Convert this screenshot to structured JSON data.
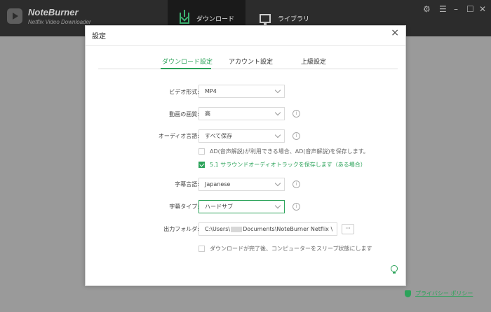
{
  "app": {
    "name": "NoteBurner",
    "subtitle": "Netflix Video Downloader",
    "nav": {
      "download": "ダウンロード",
      "library": "ライブラリ"
    }
  },
  "dialog": {
    "title": "設定",
    "tabs": [
      "ダウンロード設定",
      "アカウント設定",
      "上級設定"
    ],
    "video_format": {
      "label": "ビデオ形式:",
      "value": "MP4"
    },
    "video_quality": {
      "label": "動画の画質:",
      "value": "高"
    },
    "audio_language": {
      "label": "オーディオ言語:",
      "value": "すべて保存"
    },
    "ad_option": {
      "text": "AD(音声解説)が利用できる場合、AD(音声解説)を保存します。",
      "checked": false
    },
    "surround_option": {
      "text": "5.1 サラウンドオーディオトラックを保存します（ある場合）",
      "checked": true
    },
    "subtitle_language": {
      "label": "字幕言語:",
      "value": "Japanese"
    },
    "subtitle_type": {
      "label": "字幕タイプ:",
      "value": "ハードサブ"
    },
    "output_folder": {
      "label": "出力フォルダ:",
      "prefix": "C:\\Users\\",
      "suffix": "Documents\\NoteBurner Netflix \\",
      "browse": "···"
    },
    "sleep_option": {
      "text": "ダウンロードが完了後、コンピューターをスリープ状態にします",
      "checked": false
    }
  },
  "footer": {
    "privacy": "プライバシー ポリシー"
  },
  "colors": {
    "accent": "#2ca35a",
    "titlebar": "#2c2c2c"
  }
}
